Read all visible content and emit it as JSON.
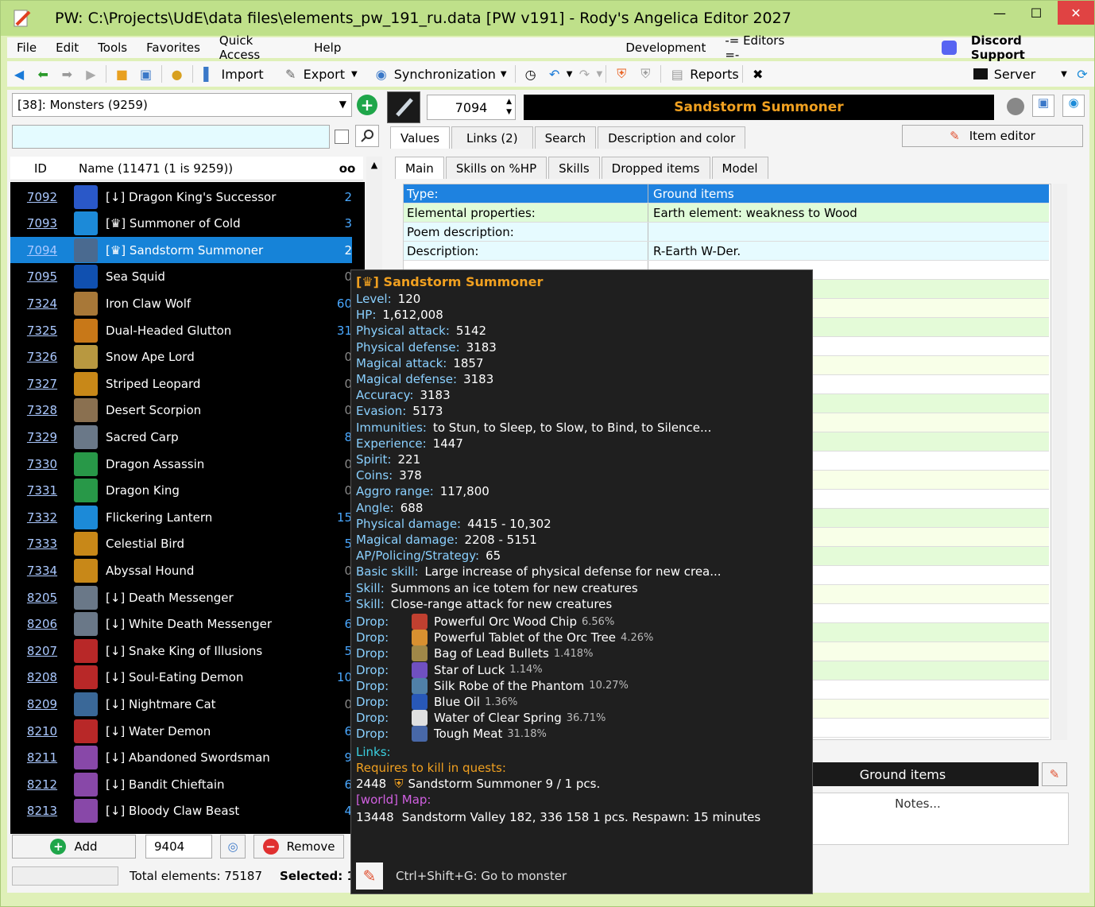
{
  "window": {
    "title": "PW: C:\\Projects\\UdE\\data files\\elements_pw_191_ru.data [PW v191]  -  Rody's Angelica Editor 2027",
    "minimize": "—",
    "maximize": "☐",
    "close": "✕"
  },
  "menu": {
    "items": [
      "File",
      "Edit",
      "Tools",
      "Favorites",
      "Quick Access",
      "Help"
    ],
    "development": "Development",
    "editors": "-= Editors =-",
    "discord": "Discord Support"
  },
  "toolbar": {
    "import": "Import",
    "export": "Export",
    "sync": "Synchronization",
    "reports": "Reports",
    "server": "Server"
  },
  "left": {
    "category": "[38]: Monsters (9259)",
    "search_value": "",
    "col_id": "ID",
    "col_name": "Name (11471 (1 is 9259))",
    "col_count": "oo",
    "rows": [
      {
        "id": "7092",
        "name": "[↓] Dragon King's Successor",
        "count": "2",
        "color": "#2a58c8",
        "count_color": "#4aa8ff"
      },
      {
        "id": "7093",
        "name": "[♛] Summoner of Cold",
        "count": "3",
        "color": "#1c8ad8",
        "count_color": "#4aa8ff"
      },
      {
        "id": "7094",
        "name": "[♛] Sandstorm Summoner",
        "count": "2",
        "color": "#4a6a90",
        "count_color": "#ffffff"
      },
      {
        "id": "7095",
        "name": "Sea Squid",
        "count": "0",
        "color": "#1050b0",
        "count_color": "#888888"
      },
      {
        "id": "7324",
        "name": "Iron Claw Wolf",
        "count": "60",
        "color": "#a87838",
        "count_color": "#4aa8ff"
      },
      {
        "id": "7325",
        "name": "Dual-Headed Glutton",
        "count": "31",
        "color": "#c87818",
        "count_color": "#4aa8ff"
      },
      {
        "id": "7326",
        "name": "Snow Ape Lord",
        "count": "0",
        "color": "#b89840",
        "count_color": "#888888"
      },
      {
        "id": "7327",
        "name": "Striped Leopard",
        "count": "0",
        "color": "#c88818",
        "count_color": "#888888"
      },
      {
        "id": "7328",
        "name": "Desert Scorpion",
        "count": "0",
        "color": "#8a7050",
        "count_color": "#888888"
      },
      {
        "id": "7329",
        "name": "Sacred Carp",
        "count": "8",
        "color": "#6a7888",
        "count_color": "#4aa8ff"
      },
      {
        "id": "7330",
        "name": "Dragon Assassin",
        "count": "0",
        "color": "#289848",
        "count_color": "#888888"
      },
      {
        "id": "7331",
        "name": "Dragon King",
        "count": "0",
        "color": "#289848",
        "count_color": "#888888"
      },
      {
        "id": "7332",
        "name": "Flickering Lantern",
        "count": "15",
        "color": "#1c8ad8",
        "count_color": "#4aa8ff"
      },
      {
        "id": "7333",
        "name": "Celestial Bird",
        "count": "5",
        "color": "#c88818",
        "count_color": "#4aa8ff"
      },
      {
        "id": "7334",
        "name": "Abyssal Hound",
        "count": "0",
        "color": "#c88818",
        "count_color": "#888888"
      },
      {
        "id": "8205",
        "name": "[↓] Death Messenger",
        "count": "5",
        "color": "#6a7888",
        "count_color": "#4aa8ff"
      },
      {
        "id": "8206",
        "name": "[↓] White Death Messenger",
        "count": "6",
        "color": "#6a7888",
        "count_color": "#4aa8ff"
      },
      {
        "id": "8207",
        "name": "[↓] Snake King of Illusions",
        "count": "5",
        "color": "#b82828",
        "count_color": "#4aa8ff"
      },
      {
        "id": "8208",
        "name": "[↓] Soul-Eating Demon",
        "count": "10",
        "color": "#b82828",
        "count_color": "#4aa8ff"
      },
      {
        "id": "8209",
        "name": "[↓] Nightmare Cat",
        "count": "0",
        "color": "#3a6898",
        "count_color": "#888888"
      },
      {
        "id": "8210",
        "name": "[↓] Water Demon",
        "count": "6",
        "color": "#b82828",
        "count_color": "#4aa8ff"
      },
      {
        "id": "8211",
        "name": "[↓] Abandoned Swordsman",
        "count": "9",
        "color": "#8848a8",
        "count_color": "#4aa8ff"
      },
      {
        "id": "8212",
        "name": "[↓] Bandit Chieftain",
        "count": "6",
        "color": "#8848a8",
        "count_color": "#4aa8ff"
      },
      {
        "id": "8213",
        "name": "[↓] Bloody Claw Beast",
        "count": "4",
        "color": "#8848a8",
        "count_color": "#4aa8ff"
      }
    ],
    "add_label": "Add",
    "add_value": "9404",
    "remove_label": "Remove",
    "total": "Total elements: 75187",
    "selected": "Selected: 1"
  },
  "right": {
    "id_value": "7094",
    "item_name": "Sandstorm Summoner",
    "tabs": [
      "Values",
      "Links (2)",
      "Search",
      "Description and color"
    ],
    "item_editor": "Item editor",
    "subtabs": [
      "Main",
      "Skills on %HP",
      "Skills",
      "Dropped items",
      "Model"
    ],
    "grid_rows": [
      {
        "k": "Type:",
        "v": "Ground items",
        "bg": "#1e82e0",
        "fg": "#ffffff"
      },
      {
        "k": "Elemental properties:",
        "v": "Earth element: weakness to Wood",
        "bg": "#dffbd8",
        "fg": "#000000"
      },
      {
        "k": "Poem description:",
        "v": "",
        "bg": "#e6fbff",
        "fg": "#000000"
      },
      {
        "k": "Description:",
        "v": "R-Earth W-Der.",
        "bg": "#e6fbff",
        "fg": "#000000"
      }
    ],
    "bottom_type": "Ground items",
    "notes": "Notes..."
  },
  "tooltip": {
    "title": "[♛] Sandstorm Summoner",
    "stats": [
      {
        "l": "Level:",
        "v": "120"
      },
      {
        "l": "HP:",
        "v": "1,612,008"
      },
      {
        "l": "Physical attack:",
        "v": "5142"
      },
      {
        "l": "Physical defense:",
        "v": "3183"
      },
      {
        "l": "Magical attack:",
        "v": "1857"
      },
      {
        "l": "Magical defense:",
        "v": "3183"
      },
      {
        "l": "Accuracy:",
        "v": "3183"
      },
      {
        "l": "Evasion:",
        "v": "5173"
      },
      {
        "l": "Immunities:",
        "v": "to Stun, to Sleep, to Slow, to Bind, to Silence..."
      },
      {
        "l": "Experience:",
        "v": "1447"
      },
      {
        "l": "Spirit:",
        "v": "221"
      },
      {
        "l": "Coins:",
        "v": "378"
      },
      {
        "l": "Aggro range:",
        "v": "117,800"
      },
      {
        "l": "Angle:",
        "v": "688"
      },
      {
        "l": "Physical damage:",
        "v": "4415 - 10,302"
      },
      {
        "l": "Magical damage:",
        "v": "2208 - 5151"
      },
      {
        "l": "AP/Policing/Strategy:",
        "v": "65"
      },
      {
        "l": "Basic skill:",
        "v": "Large increase of physical defense for new crea..."
      },
      {
        "l": "Skill:",
        "v": "Summons an ice totem for new creatures"
      },
      {
        "l": "Skill:",
        "v": "Close-range attack for new creatures"
      }
    ],
    "drop_label": "Drop:",
    "drops": [
      {
        "name": "Powerful Orc Wood Chip",
        "pct": "6.56%",
        "color": "#c04030"
      },
      {
        "name": "Powerful Tablet of the Orc Tree",
        "pct": "4.26%",
        "color": "#d89030"
      },
      {
        "name": "Bag of Lead Bullets",
        "pct": "1.418%",
        "color": "#a08848"
      },
      {
        "name": "Star of Luck",
        "pct": "1.14%",
        "color": "#7050c0"
      },
      {
        "name": "Silk Robe of the Phantom",
        "pct": "10.27%",
        "color": "#5080a8"
      },
      {
        "name": "Blue Oil",
        "pct": "1.36%",
        "color": "#2858b8"
      },
      {
        "name": "Water of Clear Spring",
        "pct": "36.71%",
        "color": "#e0e0e0"
      },
      {
        "name": "Tough Meat",
        "pct": "31.18%",
        "color": "#4868a8"
      }
    ],
    "links": "Links:",
    "quests_label": "Requires to kill in quests:",
    "quest_id": "2448",
    "quest_text": "Sandstorm Summoner 9 / 1 pcs.",
    "map_label": "[world] Map:",
    "map_id": "13448",
    "map_text": "Sandstorm Valley  182, 336 158  1  pcs.  Respawn: 15 minutes",
    "hint": "Ctrl+Shift+G: Go to monster"
  }
}
